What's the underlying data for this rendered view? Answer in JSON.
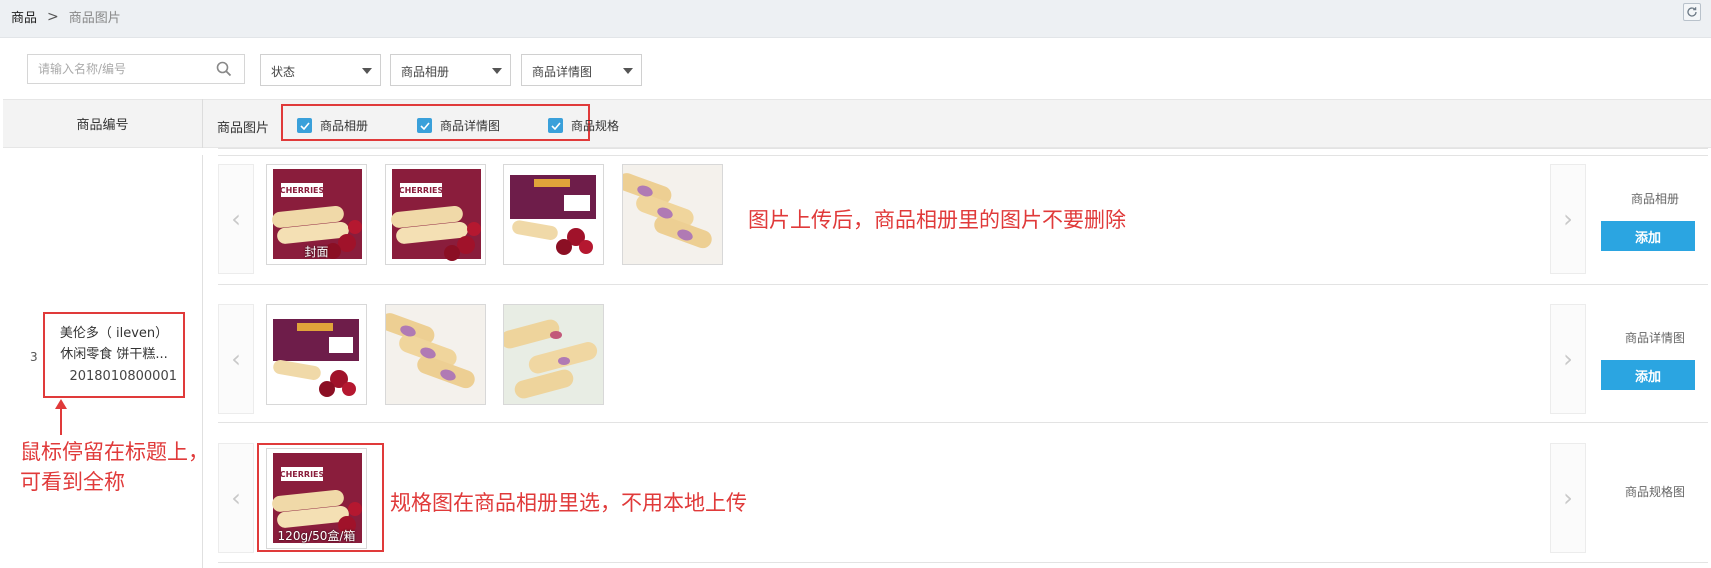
{
  "breadcrumb": {
    "root": "商品",
    "separator": ">",
    "current": "商品图片"
  },
  "filters": {
    "search_placeholder": "请输入名称/编号",
    "status": "状态",
    "album": "商品相册",
    "detail": "商品详情图"
  },
  "table": {
    "col_code": "商品编号",
    "col_images": "商品图片",
    "checks": [
      {
        "label": "商品相册",
        "checked": true
      },
      {
        "label": "商品详情图",
        "checked": true
      },
      {
        "label": "商品规格",
        "checked": true
      }
    ]
  },
  "row": {
    "index": "3",
    "title_line1": "美伦多（ ileven）",
    "title_line2": "休闲零食 饼干糕...",
    "code": "2018010800001",
    "album": {
      "label": "商品相册",
      "add": "添加",
      "cover_caption": "封面"
    },
    "detail": {
      "label": "商品详情图",
      "add": "添加"
    },
    "spec": {
      "label": "商品规格图",
      "caption": "120g/50盒/箱"
    }
  },
  "annotations": {
    "album_note": "图片上传后，商品相册里的图片不要删除",
    "hover_note_1": "鼠标停留在标题上，",
    "hover_note_2": "可看到全称",
    "spec_note": "规格图在商品相册里选，不用本地上传"
  },
  "colors": {
    "accent": "#2ba5e1",
    "annotation_red": "#e03a3a",
    "checkbox": "#3aa0da"
  },
  "icons": {
    "search": "search-icon",
    "refresh": "refresh-icon",
    "prev": "chevron-left-icon",
    "next": "chevron-right-icon",
    "check": "check-icon"
  }
}
